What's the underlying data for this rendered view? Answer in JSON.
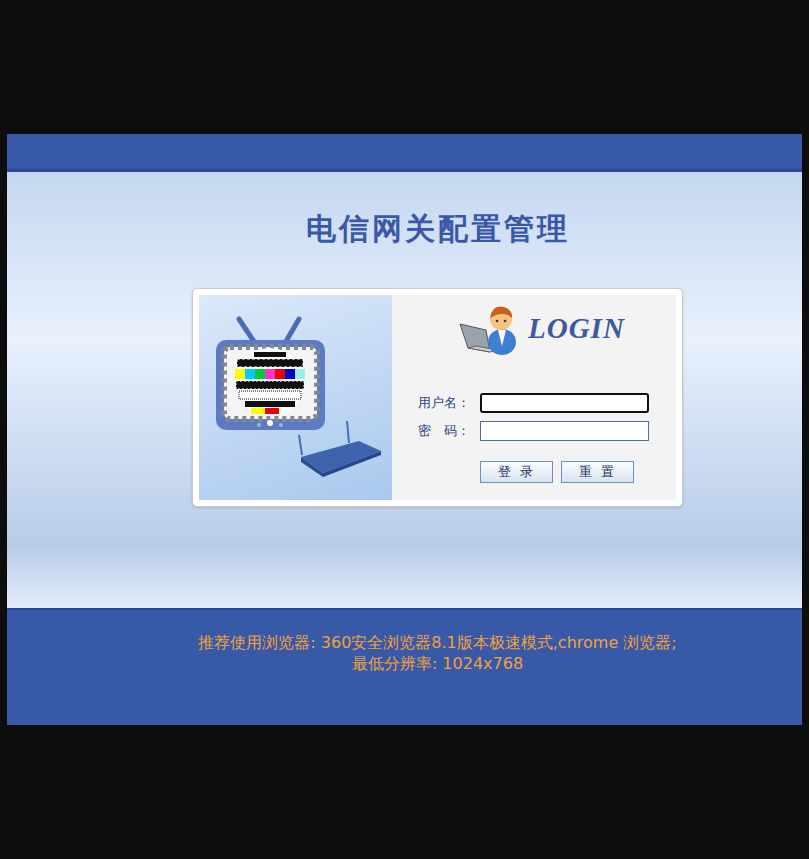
{
  "title": "电信网关配置管理",
  "login": {
    "heading": "LOGIN",
    "fields": [
      {
        "label": "用户名：",
        "value": "",
        "focused": true
      },
      {
        "label": "密　码：",
        "value": "",
        "focused": false
      }
    ],
    "buttons": [
      "登 录",
      "重 置"
    ]
  },
  "footer": {
    "lines": [
      "推荐使用浏览器: 360安全浏览器8.1版本极速模式,chrome 浏览器;",
      "最低分辨率: 1024x768"
    ]
  }
}
